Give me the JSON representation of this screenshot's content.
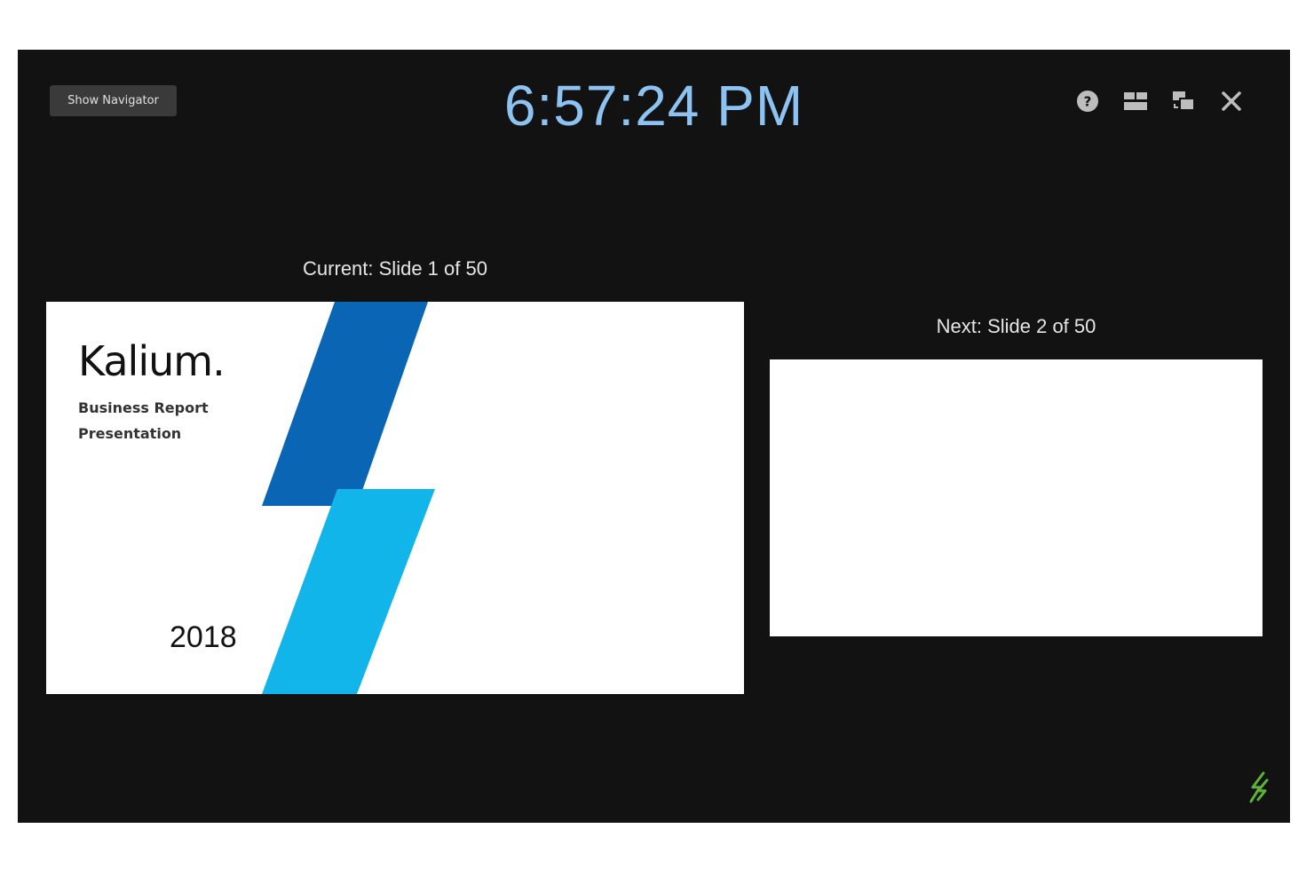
{
  "header": {
    "nav_button_label": "Show Navigator",
    "clock": "6:57:24 PM"
  },
  "toolbar": {
    "items": [
      {
        "icon": "help-icon"
      },
      {
        "icon": "layout-icon"
      },
      {
        "icon": "swap-displays-icon"
      },
      {
        "icon": "close-icon"
      }
    ]
  },
  "current": {
    "label": "Current: Slide 1 of 50",
    "slide": {
      "title": "Kalium.",
      "subtitle": "Business Report Presentation",
      "year": "2018",
      "colors": {
        "dark_blue": "#0a66b5",
        "light_blue": "#11b5ea"
      }
    }
  },
  "next": {
    "label": "Next: Slide 2 of 50"
  },
  "colors": {
    "background": "#121212",
    "clock": "#8cc3f2",
    "button": "#3a3a3a",
    "logo": "#5bb33a"
  }
}
